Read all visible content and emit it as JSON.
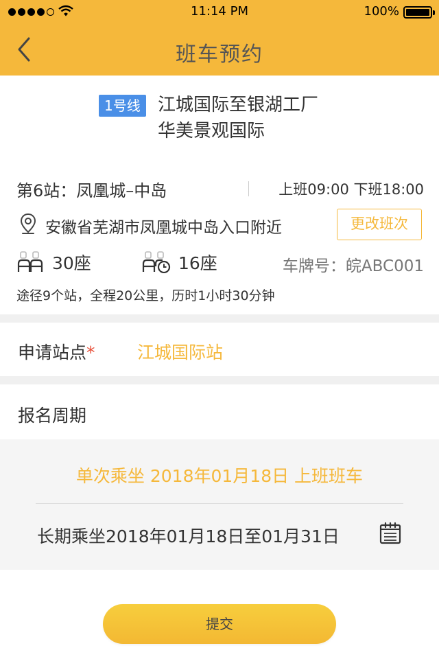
{
  "status_bar": {
    "time": "11:14 PM",
    "battery": "100%"
  },
  "header": {
    "title": "班车预约",
    "back_icon": "chevron-left-icon"
  },
  "route": {
    "badge": "1号线",
    "title_line1": "江城国际至银湖工厂",
    "title_line2": "华美景观国际"
  },
  "stop": {
    "name": "第6站：凤凰城–中岛",
    "work_time": "上班09:00  下班18:00"
  },
  "address": {
    "text": "安徽省芜湖市凤凰城中岛入口附近",
    "change_label": "更改班次"
  },
  "seats": {
    "total": "30座",
    "remaining": "16座",
    "plate": "车牌号：皖ABC001"
  },
  "summary": "途径9个站，全程20公里，历时1小时30分钟",
  "station": {
    "label": "申请站点",
    "required_mark": "*",
    "value": "江城国际站"
  },
  "period": {
    "label": "报名周期",
    "single": "单次乘坐 2018年01月18日 上班班车",
    "long": "长期乘坐2018年01月18日至01月31日",
    "calendar_icon": "calendar-icon"
  },
  "submit_label": "提交",
  "colors": {
    "accent": "#F5B83B",
    "badge": "#4A8FE7",
    "required": "#E8503A"
  }
}
